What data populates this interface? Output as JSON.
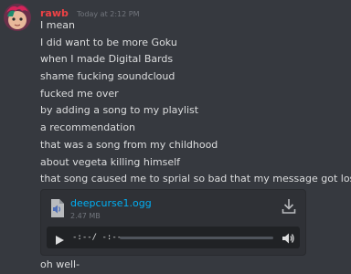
{
  "message": {
    "username": "rawb",
    "timestamp": "Today at 2:12 PM",
    "username_color": "#ed4245",
    "lines": [
      "I mean",
      "I did want to be more Goku",
      "when I made Digital Bards",
      "shame fucking soundcloud",
      "fucked me over",
      "by adding a song to my playlist",
      "a recommendation",
      "that was a song from my childhood",
      "about vegeta killing himself",
      "that song caused me to sprial so bad that my message got lost"
    ],
    "attachment": {
      "file_name": "deepcurse1.ogg",
      "file_size": "2.47 MB",
      "file_icon": "audio-file-icon",
      "download_icon": "download-icon",
      "player": {
        "time": "-:--/ -:--",
        "progress": 0.0,
        "play_icon": "play-icon",
        "volume_icon": "volume-icon"
      }
    },
    "after_text": "oh well-"
  },
  "colors": {
    "background": "#36393f",
    "link": "#00aff4",
    "muted": "#72767d",
    "text": "#dcddde"
  }
}
